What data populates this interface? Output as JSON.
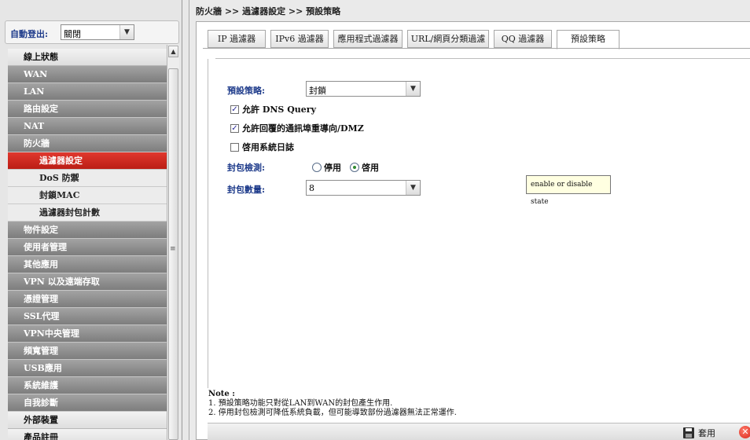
{
  "sidebar": {
    "logout_label": "自動登出:",
    "logout_value": "關閉",
    "items": [
      {
        "label": "線上狀態",
        "style": "light"
      },
      {
        "label": "WAN",
        "style": "dark"
      },
      {
        "label": "LAN",
        "style": "dark"
      },
      {
        "label": "路由設定",
        "style": "dark"
      },
      {
        "label": "NAT",
        "style": "dark"
      },
      {
        "label": "防火牆",
        "style": "dark"
      },
      {
        "label": "過濾器設定",
        "style": "active"
      },
      {
        "label": "DoS 防禦",
        "style": "sub"
      },
      {
        "label": "封鎖MAC",
        "style": "sub"
      },
      {
        "label": "過濾器封包計數",
        "style": "sub"
      },
      {
        "label": "物件設定",
        "style": "dark"
      },
      {
        "label": "使用者管理",
        "style": "dark"
      },
      {
        "label": "其他應用",
        "style": "dark"
      },
      {
        "label": "VPN 以及遠端存取",
        "style": "dark"
      },
      {
        "label": "憑證管理",
        "style": "dark"
      },
      {
        "label": "SSL代理",
        "style": "dark"
      },
      {
        "label": "VPN中央管理",
        "style": "dark"
      },
      {
        "label": "頻寬管理",
        "style": "dark"
      },
      {
        "label": "USB應用",
        "style": "dark"
      },
      {
        "label": "系統維護",
        "style": "dark"
      },
      {
        "label": "自我診斷",
        "style": "dark"
      },
      {
        "label": "外部裝置",
        "style": "light"
      },
      {
        "label": "產品註冊",
        "style": "light"
      }
    ]
  },
  "breadcrumb": "防火牆 >> 過濾器設定 >> 預設策略",
  "tabs": [
    {
      "label": "IP 過濾器",
      "selected": false
    },
    {
      "label": "IPv6 過濾器",
      "selected": false
    },
    {
      "label": "應用程式過濾器",
      "selected": false
    },
    {
      "label": "URL/網頁分類過濾",
      "selected": false
    },
    {
      "label": "QQ 過濾器",
      "selected": false
    },
    {
      "label": "預設策略",
      "selected": true
    }
  ],
  "form": {
    "policy_label": "預設策略:",
    "policy_value": "封鎖",
    "allow_dns_label": "允許 DNS Query",
    "allow_dns_checked": true,
    "allow_redirect_label": "允許回覆的通訊埠重導向/DMZ",
    "allow_redirect_checked": true,
    "syslog_label": "啓用系統日誌",
    "syslog_checked": false,
    "packet_check_label": "封包檢測:",
    "radio_disable_label": "停用",
    "radio_enable_label": "啓用",
    "radio_selected": "enable",
    "packet_count_label": "封包數量:",
    "packet_count_value": "8"
  },
  "tooltip": "enable or disable state",
  "notes": {
    "title": "Note :",
    "line1": "1. 預設策略功能只對從LAN到WAN的封包產生作用.",
    "line2": "2. 停用封包檢測可降低系統負載，但可能導致部份過濾器無法正常運作."
  },
  "footer": {
    "apply_label": "套用"
  },
  "icons": {
    "dropdown": "chevron-down-icon",
    "scroll_up": "arrow-up-icon",
    "apply": "save-icon",
    "cancel": "cancel-icon"
  },
  "colors": {
    "label_blue": "#1d3a8a",
    "active_red": "#d02a22",
    "tooltip_bg": "#ffffe1"
  }
}
